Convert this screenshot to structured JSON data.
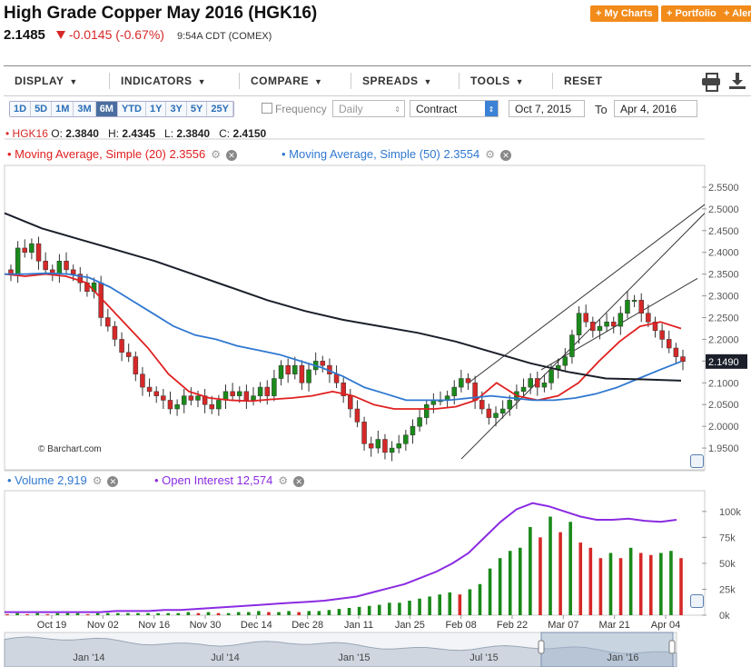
{
  "header": {
    "title": "High Grade Copper May 2016 (HGK16)",
    "last": "2.1485",
    "change": "-0.0145 (-0.67%)",
    "time": "9:54A CDT (COMEX)",
    "buttons": [
      "+ My Charts",
      "+ Portfolio",
      "+ Alerts"
    ]
  },
  "toolbar": {
    "items": [
      "DISPLAY",
      "INDICATORS",
      "COMPARE",
      "SPREADS",
      "TOOLS",
      "RESET"
    ],
    "print_icon": "print-icon",
    "download_icon": "download-icon"
  },
  "controls": {
    "periods": [
      "1D",
      "5D",
      "1M",
      "3M",
      "6M",
      "YTD",
      "1Y",
      "3Y",
      "5Y",
      "25Y"
    ],
    "selected_period": "6M",
    "frequency_label": "Frequency",
    "frequency_value": "Daily",
    "contract_value": "Contract",
    "from_date": "Oct 7, 2015",
    "to_label": "To",
    "to_date": "Apr 4, 2016"
  },
  "ohlc": {
    "symbol": "HGK16",
    "o_label": "O:",
    "o": "2.3840",
    "h_label": "H:",
    "h": "2.4345",
    "l_label": "L:",
    "l": "2.3840",
    "c_label": "C:",
    "c": "2.4150"
  },
  "legend": {
    "ma20": "Moving Average, Simple (20) 2.3556",
    "ma50": "Moving Average, Simple (50) 2.3554",
    "volume": "Volume 2,919",
    "open_interest": "Open Interest 12,574"
  },
  "watermark": "© Barchart.com",
  "colors": {
    "up": "#1a8a1a",
    "down": "#d62828",
    "ma20": "#e02020",
    "ma50": "#2f78d0",
    "ma200": "#1b1f2a",
    "open_interest": "#8a2be2",
    "accent": "#f28b1a"
  },
  "chart_data": [
    {
      "type": "candlestick",
      "title": "",
      "ylim": [
        1.9,
        2.6
      ],
      "yticks": [
        "2.5500",
        "2.5000",
        "2.4500",
        "2.4000",
        "2.3500",
        "2.3000",
        "2.2500",
        "2.2000",
        "2.1500",
        "2.1000",
        "2.0500",
        "2.0000",
        "1.9500"
      ],
      "price_tag": "2.1490",
      "x_labels": [
        "Oct 19",
        "Nov 02",
        "Nov 16",
        "Nov 30",
        "Dec 14",
        "Dec 28",
        "Jan 11",
        "Jan 25",
        "Feb 08",
        "Feb 22",
        "Mar 07",
        "Mar 21",
        "Apr 04"
      ],
      "close_series": [
        2.35,
        2.41,
        2.4,
        2.42,
        2.38,
        2.36,
        2.35,
        2.38,
        2.36,
        2.35,
        2.33,
        2.31,
        2.33,
        2.25,
        2.23,
        2.2,
        2.17,
        2.16,
        2.12,
        2.09,
        2.08,
        2.07,
        2.06,
        2.04,
        2.05,
        2.07,
        2.06,
        2.07,
        2.05,
        2.04,
        2.06,
        2.08,
        2.07,
        2.08,
        2.06,
        2.07,
        2.09,
        2.07,
        2.11,
        2.14,
        2.12,
        2.14,
        2.1,
        2.13,
        2.15,
        2.14,
        2.12,
        2.1,
        2.07,
        2.04,
        2.01,
        1.96,
        1.95,
        1.97,
        1.94,
        1.95,
        1.96,
        1.98,
        2.0,
        2.02,
        2.05,
        2.06,
        2.06,
        2.07,
        2.09,
        2.11,
        2.1,
        2.06,
        2.04,
        2.02,
        2.03,
        2.04,
        2.06,
        2.08,
        2.09,
        2.11,
        2.09,
        2.1,
        2.13,
        2.14,
        2.16,
        2.21,
        2.26,
        2.24,
        2.22,
        2.23,
        2.24,
        2.23,
        2.26,
        2.29,
        2.29,
        2.26,
        2.24,
        2.22,
        2.2,
        2.18,
        2.16,
        2.149
      ],
      "moving_averages": [
        {
          "name": "Moving Average, Simple (20)",
          "values": [
            2.35,
            2.345,
            2.35,
            2.345,
            2.33,
            2.28,
            2.23,
            2.18,
            2.12,
            2.08,
            2.065,
            2.06,
            2.058,
            2.062,
            2.065,
            2.07,
            2.08,
            2.07,
            2.05,
            2.04,
            2.04,
            2.04,
            2.045,
            2.06,
            2.1,
            2.07,
            2.06,
            2.07,
            2.1,
            2.15,
            2.195,
            2.23,
            2.24,
            2.225
          ]
        },
        {
          "name": "Moving Average, Simple (50)",
          "values": [
            2.35,
            2.35,
            2.352,
            2.35,
            2.342,
            2.32,
            2.29,
            2.26,
            2.23,
            2.21,
            2.2,
            2.185,
            2.175,
            2.165,
            2.15,
            2.135,
            2.115,
            2.09,
            2.075,
            2.06,
            2.06,
            2.06,
            2.065,
            2.07,
            2.065,
            2.06,
            2.06,
            2.065,
            2.075,
            2.09,
            2.11,
            2.13,
            2.149
          ]
        },
        {
          "name": "Moving Average, Simple (200)",
          "values": [
            2.49,
            2.455,
            2.43,
            2.405,
            2.38,
            2.35,
            2.32,
            2.29,
            2.265,
            2.245,
            2.23,
            2.215,
            2.195,
            2.17,
            2.145,
            2.125,
            2.11,
            2.108,
            2.105
          ]
        }
      ]
    },
    {
      "type": "bar",
      "title": "",
      "ylim": [
        0,
        120000
      ],
      "yticks": [
        "100k",
        "75k",
        "50k",
        "25k",
        "0k"
      ],
      "volume_thousands": [
        1,
        2,
        1,
        2,
        1,
        2,
        2,
        2,
        1,
        2,
        2,
        2,
        2,
        2,
        2,
        2,
        2,
        2,
        3,
        2,
        3,
        2,
        2,
        3,
        3,
        4,
        3,
        3,
        4,
        3,
        4,
        4,
        5,
        6,
        7,
        8,
        9,
        10,
        12,
        12,
        14,
        16,
        18,
        20,
        22,
        20,
        25,
        30,
        45,
        55,
        62,
        65,
        85,
        75,
        95,
        80,
        90,
        70,
        65,
        55,
        60,
        55,
        65,
        60,
        58,
        60,
        62,
        55
      ],
      "open_interest_thousands": [
        3,
        3,
        3,
        3,
        3,
        3,
        3,
        4,
        4,
        4,
        5,
        5,
        6,
        7,
        8,
        9,
        10,
        11,
        12,
        13,
        14,
        16,
        18,
        22,
        26,
        30,
        36,
        42,
        50,
        60,
        75,
        90,
        102,
        108,
        105,
        100,
        95,
        92,
        92,
        93,
        91,
        90,
        92
      ]
    }
  ],
  "navigator": {
    "labels": [
      "Jan '14",
      "Jul '14",
      "Jan '15",
      "Jul '15",
      "Jan '16"
    ]
  }
}
